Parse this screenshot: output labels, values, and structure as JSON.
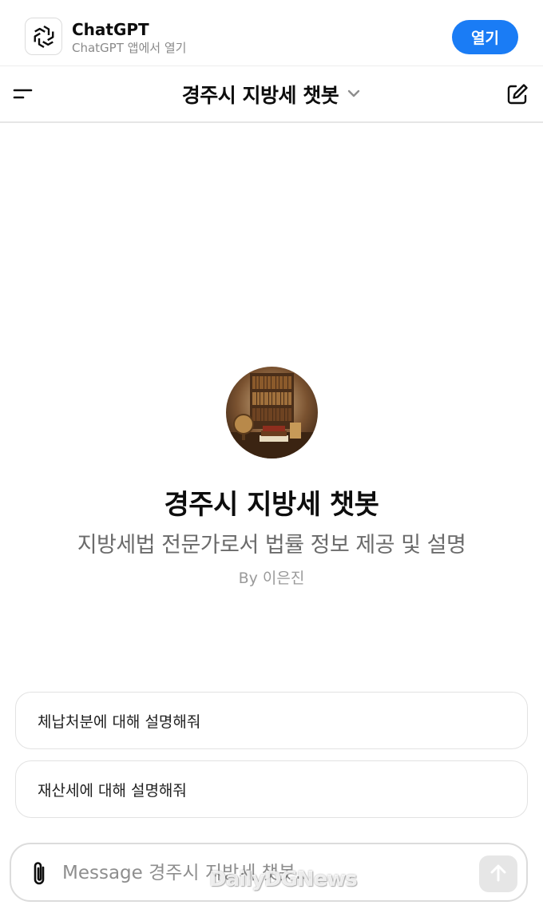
{
  "app_banner": {
    "app_name": "ChatGPT",
    "subtitle": "ChatGPT 앱에서 열기",
    "open_label": "열기",
    "logo_icon": "openai-logo-icon",
    "accent_color": "#1a7cf5"
  },
  "header": {
    "title": "경주시 지방세 챗봇",
    "menu_icon": "menu-icon",
    "dropdown_icon": "chevron-down-icon",
    "new_chat_icon": "edit-icon"
  },
  "gpt": {
    "name": "경주시 지방세 챗봇",
    "description": "지방세법 전문가로서 법률 정보 제공 및 설명",
    "author": "By 이은진",
    "avatar_icon": "library-avatar"
  },
  "suggestions": [
    {
      "label": "체납처분에 대해 설명해줘"
    },
    {
      "label": "재산세에 대해 설명해줘"
    }
  ],
  "composer": {
    "placeholder": "Message 경주시 지방세 챗봇...",
    "value": "",
    "attach_icon": "paperclip-icon",
    "send_icon": "arrow-up-icon"
  },
  "watermark": {
    "text": "DailyDGNews"
  }
}
